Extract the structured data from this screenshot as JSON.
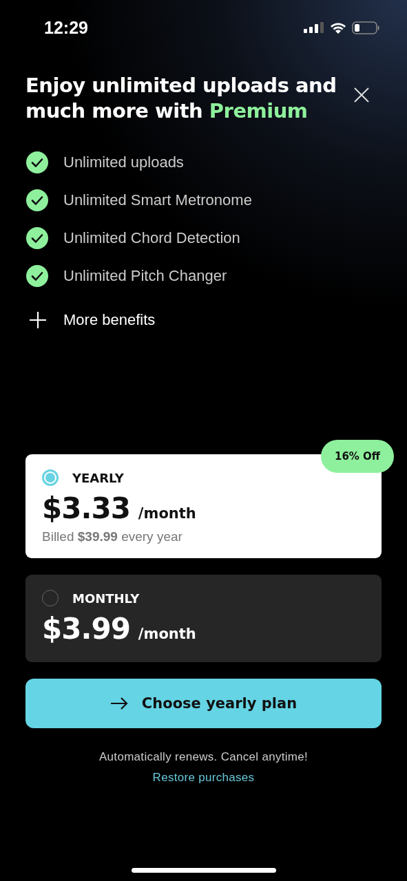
{
  "status_bar": {
    "time": "12:29"
  },
  "title": {
    "text": "Enjoy unlimited uploads and much more with",
    "highlight": "Premium"
  },
  "features": [
    {
      "label": "Unlimited uploads",
      "kind": "check"
    },
    {
      "label": "Unlimited Smart Metronome",
      "kind": "check"
    },
    {
      "label": "Unlimited Chord Detection",
      "kind": "check"
    },
    {
      "label": "Unlimited Pitch Changer",
      "kind": "check"
    },
    {
      "label": "More benefits",
      "kind": "more"
    }
  ],
  "plans": [
    {
      "name": "YEARLY",
      "price": "$3.33",
      "unit": "/month",
      "billing": "Billed **$39.99** every year",
      "badge": "16% Off",
      "selected": true
    },
    {
      "name": "MONTHLY",
      "price": "$3.99",
      "unit": "/month",
      "selected": false
    }
  ],
  "cta": {
    "label": "Choose yearly plan"
  },
  "footer": {
    "note": "Automatically renews. Cancel anytime!",
    "link": "Restore purchases"
  }
}
